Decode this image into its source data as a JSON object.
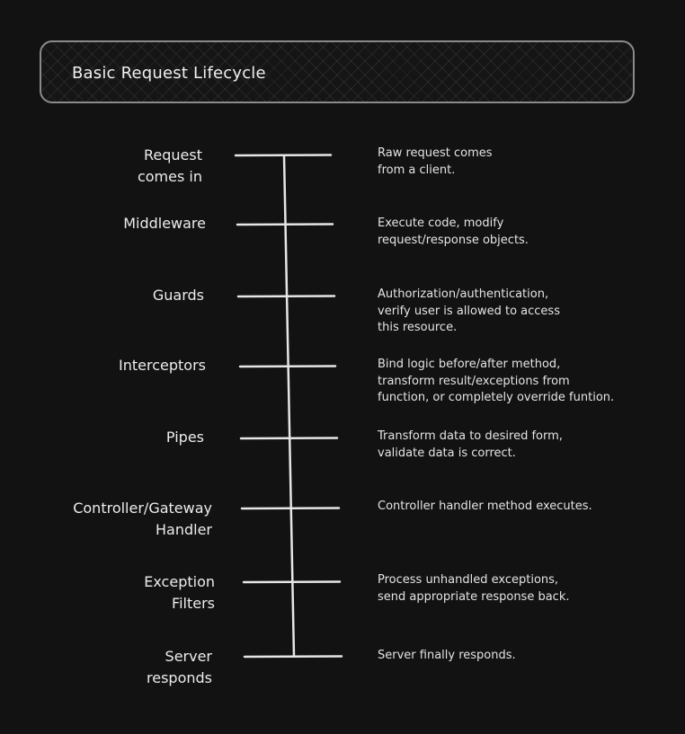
{
  "title": "Basic Request Lifecycle",
  "colors": {
    "background": "#121212",
    "stroke": "#e6e6e6",
    "box_border": "#8a8a8a",
    "text": "#ececec"
  },
  "stages": [
    {
      "label": "Request\ncomes in",
      "description": "Raw request comes\nfrom a client."
    },
    {
      "label": "Middleware",
      "description": "Execute code, modify\nrequest/response objects."
    },
    {
      "label": "Guards",
      "description": "Authorization/authentication,\nverify user is allowed to access\nthis resource."
    },
    {
      "label": "Interceptors",
      "description": "Bind logic before/after method,\ntransform result/exceptions from\nfunction, or completely override funtion."
    },
    {
      "label": "Pipes",
      "description": "Transform data to desired form,\nvalidate data is correct."
    },
    {
      "label": "Controller/Gateway\nHandler",
      "description": "Controller handler method executes."
    },
    {
      "label": "Exception\nFilters",
      "description": "Process unhandled exceptions,\nsend appropriate response back."
    },
    {
      "label": "Server\nresponds",
      "description": "Server finally responds."
    }
  ]
}
